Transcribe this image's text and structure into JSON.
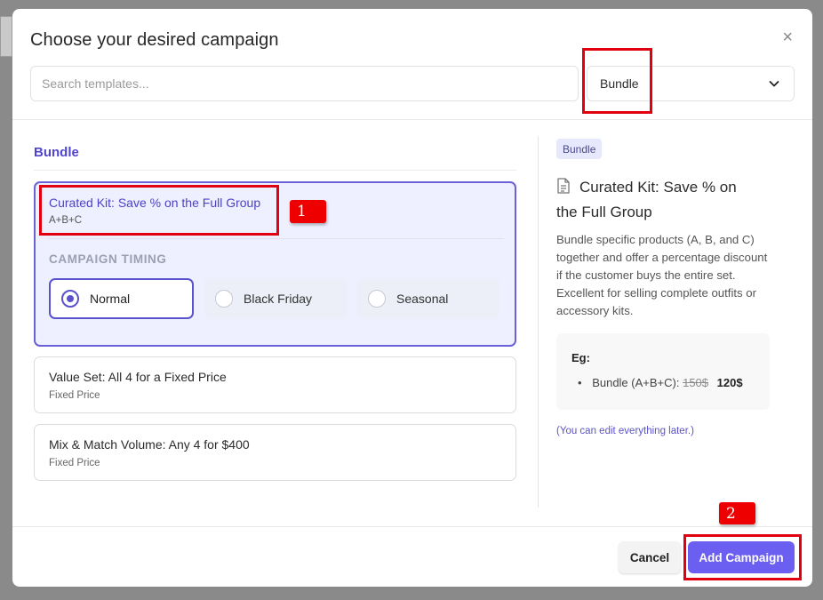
{
  "modal": {
    "title": "Choose your desired campaign",
    "close_glyph": "×"
  },
  "search": {
    "placeholder": "Search templates...",
    "value": ""
  },
  "category_select": {
    "selected": "Bundle"
  },
  "list": {
    "section_title": "Bundle",
    "templates": [
      {
        "title": "Curated Kit: Save % on the Full Group",
        "subtitle": "A+B+C",
        "selected": true
      },
      {
        "title": "Value Set: All 4 for a Fixed Price",
        "subtitle": "Fixed Price",
        "selected": false
      },
      {
        "title": "Mix & Match Volume: Any 4 for $400",
        "subtitle": "Fixed Price",
        "selected": false
      }
    ],
    "timing": {
      "label": "CAMPAIGN TIMING",
      "options": [
        "Normal",
        "Black Friday",
        "Seasonal"
      ],
      "selected": "Normal"
    }
  },
  "detail": {
    "badge": "Bundle",
    "title": "Curated Kit: Save % on the Full Group",
    "description": "Bundle specific products (A, B, and C) together and offer a percentage discount if the customer buys the entire set. Excellent for selling complete outfits or accessory kits.",
    "example": {
      "label": "Eg:",
      "item_name": "Bundle (A+B+C):",
      "old_price": "150$",
      "new_price": "120$"
    },
    "edit_note": "(You can edit everything later.)"
  },
  "footer": {
    "cancel_label": "Cancel",
    "add_label": "Add Campaign"
  },
  "annotations": {
    "tag1": "1",
    "tag2": "2"
  },
  "colors": {
    "accent": "#6a5ff0",
    "selected_border": "#6a61d6",
    "annotation": "#e00010"
  }
}
